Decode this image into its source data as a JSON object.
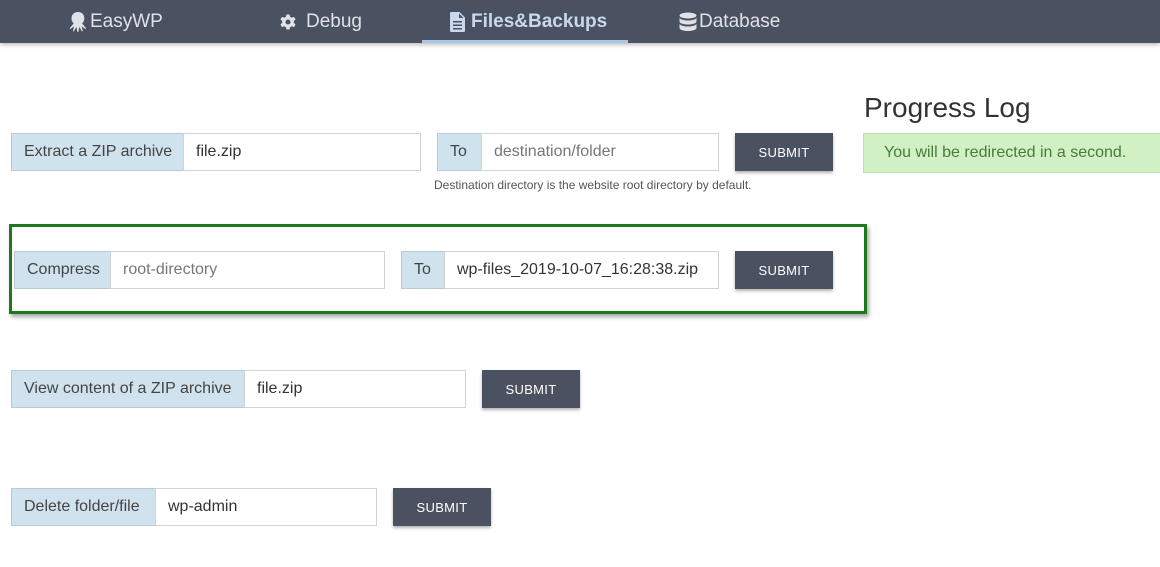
{
  "nav": {
    "items": [
      {
        "label": "EasyWP",
        "icon": "octopus-icon"
      },
      {
        "label": "Debug",
        "icon": "gear-icon"
      },
      {
        "label": "Files&Backups",
        "icon": "file-icon",
        "active": true
      },
      {
        "label": "Database",
        "icon": "database-icon"
      }
    ]
  },
  "extract": {
    "label": "Extract a ZIP archive",
    "value": "file.zip",
    "to_label": "To",
    "destination_placeholder": "destination/folder",
    "submit": "SUBMIT",
    "hint": "Destination directory is the website root directory by default."
  },
  "compress": {
    "label": "Compress",
    "placeholder": "root-directory",
    "to_label": "To",
    "value": "wp-files_2019-10-07_16:28:38.zip",
    "submit": "SUBMIT"
  },
  "view": {
    "label": "View content of a ZIP archive",
    "value": "file.zip",
    "submit": "SUBMIT"
  },
  "delete": {
    "label": "Delete folder/file",
    "value": "wp-admin",
    "submit": "SUBMIT"
  },
  "progress_log": {
    "title": "Progress Log",
    "message": "You will be redirected in a second.",
    "message_color": "#d1f0c4"
  },
  "colors": {
    "nav_bg": "#4a5160",
    "addon_bg": "#d0e2ee",
    "button_bg": "#4a5160",
    "highlight_border": "#1c7a1c"
  }
}
